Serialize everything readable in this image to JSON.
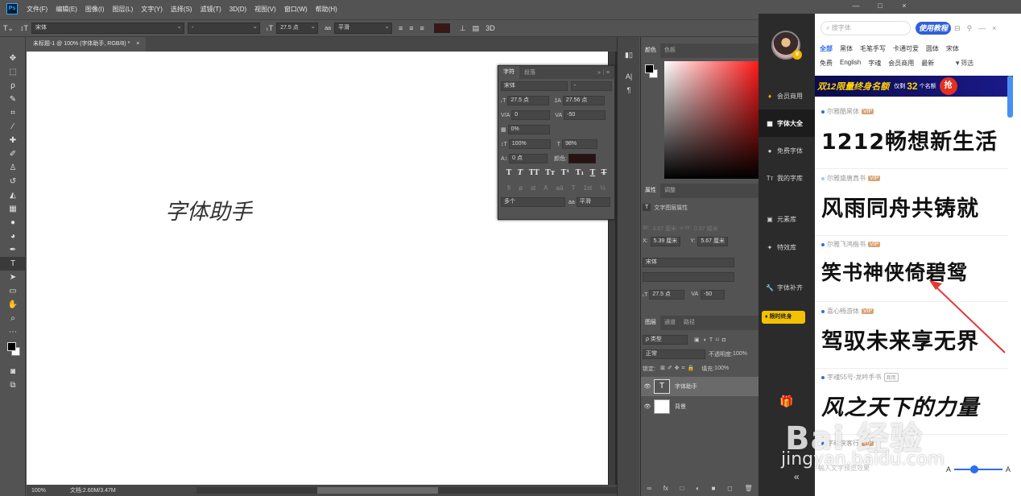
{
  "menubar": {
    "app_icon": "Ps",
    "items": [
      "文件(F)",
      "编辑(E)",
      "图像(I)",
      "图层(L)",
      "文字(Y)",
      "选择(S)",
      "滤镜(T)",
      "3D(D)",
      "视图(V)",
      "窗口(W)",
      "帮助(H)"
    ],
    "window_controls": [
      "—",
      "□",
      "×"
    ]
  },
  "optionsbar": {
    "font_family": "宋体",
    "font_style": "-",
    "font_size": "27.5 点",
    "aa_label": "aa",
    "antialias": "平滑",
    "mode_3d": "3D"
  },
  "document": {
    "tab_title": "未标题-1 @ 100% (字体助手, RGB/8) *",
    "tab_close": "×",
    "canvas_text": "字体助手",
    "zoom": "100%",
    "doc_info": "文档:2.60M/3.47M"
  },
  "character_panel": {
    "tabs": [
      "字符",
      "段落"
    ],
    "font_family": "宋体",
    "font_style": "-",
    "font_size": "27.5 点",
    "leading": "27.56 点",
    "kerning": "0",
    "tracking": "-50",
    "tsume": "0%",
    "vscale": "100%",
    "hscale": "98%",
    "baseline": "0 点",
    "color_label": "颜色:",
    "language": "多个",
    "aa_label": "aa",
    "antialias": "平滑",
    "style_buttons": [
      "T",
      "T",
      "TT",
      "Tт",
      "T¹",
      "T₁",
      "T",
      "T"
    ],
    "ot_buttons": [
      "fi",
      "ø",
      "st",
      "A",
      "aā",
      "T",
      "1st",
      "½"
    ]
  },
  "panels": {
    "color_tabs": [
      "颜色",
      "色板"
    ],
    "properties_tabs": [
      "属性",
      "调整"
    ],
    "properties_title": "文字图层属性",
    "w_label": "W:",
    "w_value": "3.67 厘米",
    "h_label": "H:",
    "h_value": "0.97 厘米",
    "x_label": "X:",
    "x_value": "5.39 厘米",
    "y_label": "Y:",
    "y_value": "5.67 厘米",
    "font_family": "宋体",
    "font_size": "27.5 点",
    "tracking": "-50",
    "layers_tabs": [
      "图层",
      "通道",
      "路径"
    ],
    "kind_filter": "ρ 类型",
    "blend_mode": "正常",
    "opacity_label": "不透明度:",
    "opacity": "100%",
    "lock_label": "锁定:",
    "fill_label": "填充:",
    "fill": "100%",
    "layers": [
      {
        "name": "字体助手",
        "type": "text",
        "thumb": "T"
      },
      {
        "name": "背景",
        "type": "bg"
      }
    ],
    "layers_footer": [
      "∞",
      "fx",
      "□",
      "◐",
      "■",
      "◻",
      "🗑"
    ]
  },
  "font_helper": {
    "nav": [
      {
        "label": "会员商用",
        "icon": "diamond-icon"
      },
      {
        "label": "字体大全",
        "icon": "grid-icon"
      },
      {
        "label": "免费字体",
        "icon": "circle-icon"
      },
      {
        "label": "我的字库",
        "icon": "font-icon"
      },
      {
        "label": "元素库",
        "icon": "image-icon"
      },
      {
        "label": "特效库",
        "icon": "star-icon"
      },
      {
        "label": "字体补齐",
        "icon": "wrench-icon"
      }
    ],
    "limited_badge": "限时终身",
    "search_placeholder": "搜字体",
    "help_label": "使用教程",
    "categories_row1": [
      "全部",
      "黑体",
      "毛笔手写",
      "卡通可爱",
      "圆体",
      "宋体"
    ],
    "categories_row2": [
      "免费",
      "English",
      "字魂",
      "会员商用",
      "最新",
      "筛选"
    ],
    "banner": {
      "main": "双12限量终身名额",
      "pre": "仅剩",
      "count": "32",
      "post": "个名额",
      "button": "抢"
    },
    "fonts": [
      {
        "name": "尔雅酷黑体",
        "tag": "VIP",
        "sample": "1212畅想新生活"
      },
      {
        "name": "尔雅盛唐真书",
        "tag": "VIP",
        "sample": "风雨同舟共铸就"
      },
      {
        "name": "尔雅飞鸿楷书",
        "tag": "VIP",
        "sample": "笑书神侠倚碧鸳"
      },
      {
        "name": "喜心畅游体",
        "tag": "VIP",
        "sample": "驾驭未来享无界"
      },
      {
        "name": "字魂55号-龙吟手书",
        "tag": "商用",
        "sample": "风之天下的力量"
      },
      {
        "name": "字魂侠客行",
        "tag": "VIP",
        "sample": ""
      }
    ],
    "preview_placeholder": "输入文字预览效果",
    "slider_left": "A",
    "slider_right": "A"
  },
  "watermark": {
    "line1": "Bai 经验",
    "line2": "jingyan.baidu.com"
  },
  "colors": {
    "accent": "#2d6cf0",
    "vip": "#d9a474",
    "annotation": "#e53935"
  }
}
